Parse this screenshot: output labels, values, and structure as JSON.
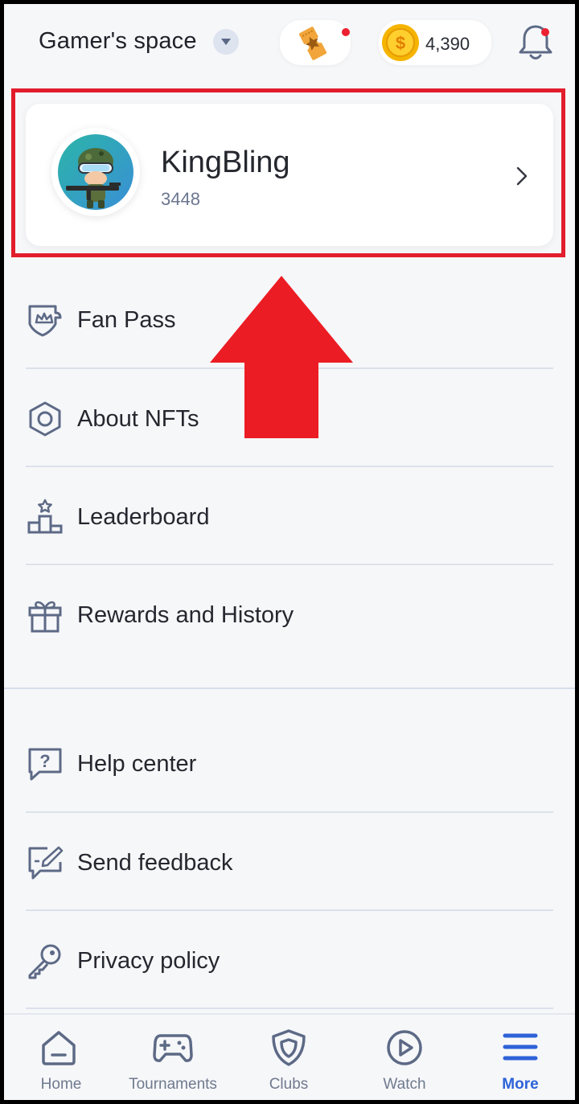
{
  "header": {
    "space_title": "Gamer's space",
    "coins": "4,390"
  },
  "profile": {
    "username": "KingBling",
    "score": "3448"
  },
  "menu": {
    "fan_pass": "Fan Pass",
    "about_nfts": "About NFTs",
    "leaderboard": "Leaderboard",
    "rewards": "Rewards and History",
    "help": "Help center",
    "feedback": "Send feedback",
    "privacy": "Privacy policy"
  },
  "nav": {
    "items": [
      {
        "label": "Home",
        "icon": "home-icon"
      },
      {
        "label": "Tournaments",
        "icon": "gamepad-icon"
      },
      {
        "label": "Clubs",
        "icon": "shield-icon"
      },
      {
        "label": "Watch",
        "icon": "play-icon"
      },
      {
        "label": "More",
        "icon": "menu-icon",
        "active": true
      }
    ]
  },
  "colors": {
    "highlight": "#e21d2c",
    "accent": "#2d62d8",
    "icon": "#5d6a86",
    "coin": "#f5b400"
  }
}
